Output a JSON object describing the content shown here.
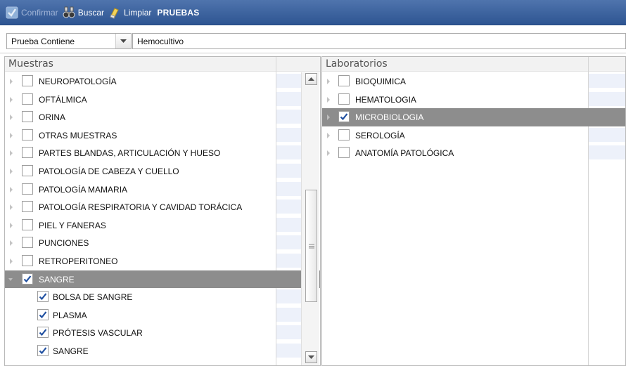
{
  "toolbar": {
    "confirm_label": "Confirmar",
    "search_label": "Buscar",
    "clear_label": "Limpiar",
    "title": "PRUEBAS"
  },
  "filter": {
    "field_selected": "Prueba Contiene",
    "value": "Hemocultivo"
  },
  "samples": {
    "title": "Muestras",
    "items": [
      {
        "label": "NEUROPATOLOGÍA",
        "checked": false
      },
      {
        "label": "OFTÁLMICA",
        "checked": false
      },
      {
        "label": "ORINA",
        "checked": false
      },
      {
        "label": "OTRAS MUESTRAS",
        "checked": false
      },
      {
        "label": "PARTES BLANDAS, ARTICULACIÓN Y HUESO",
        "checked": false
      },
      {
        "label": "PATOLOGÍA DE CABEZA Y CUELLO",
        "checked": false
      },
      {
        "label": "PATOLOGÍA MAMARIA",
        "checked": false
      },
      {
        "label": "PATOLOGÍA RESPIRATORIA Y CAVIDAD TORÁCICA",
        "checked": false
      },
      {
        "label": "PIEL Y FANERAS",
        "checked": false
      },
      {
        "label": "PUNCIONES",
        "checked": false
      },
      {
        "label": "RETROPERITONEO",
        "checked": false
      },
      {
        "label": "SANGRE",
        "checked": true,
        "expanded": true,
        "selected": true
      },
      {
        "label": "BOLSA DE SANGRE",
        "checked": true,
        "child": true
      },
      {
        "label": "PLASMA",
        "checked": true,
        "child": true
      },
      {
        "label": "PRÓTESIS VASCULAR",
        "checked": true,
        "child": true
      },
      {
        "label": "SANGRE",
        "checked": true,
        "child": true
      }
    ]
  },
  "labs": {
    "title": "Laboratorios",
    "items": [
      {
        "label": "BIOQUIMICA",
        "checked": false
      },
      {
        "label": "HEMATOLOGIA",
        "checked": false
      },
      {
        "label": "MICROBIOLOGIA",
        "checked": true,
        "selected": true
      },
      {
        "label": "SEROLOGÍA",
        "checked": false
      },
      {
        "label": "ANATOMÍA PATOLÓGICA",
        "checked": false
      }
    ]
  },
  "colors": {
    "toolbar_bg": "#2e5592",
    "selected_row": "#8d8d8d",
    "stripe": "#edf1fa",
    "check": "#1f4fa0"
  }
}
